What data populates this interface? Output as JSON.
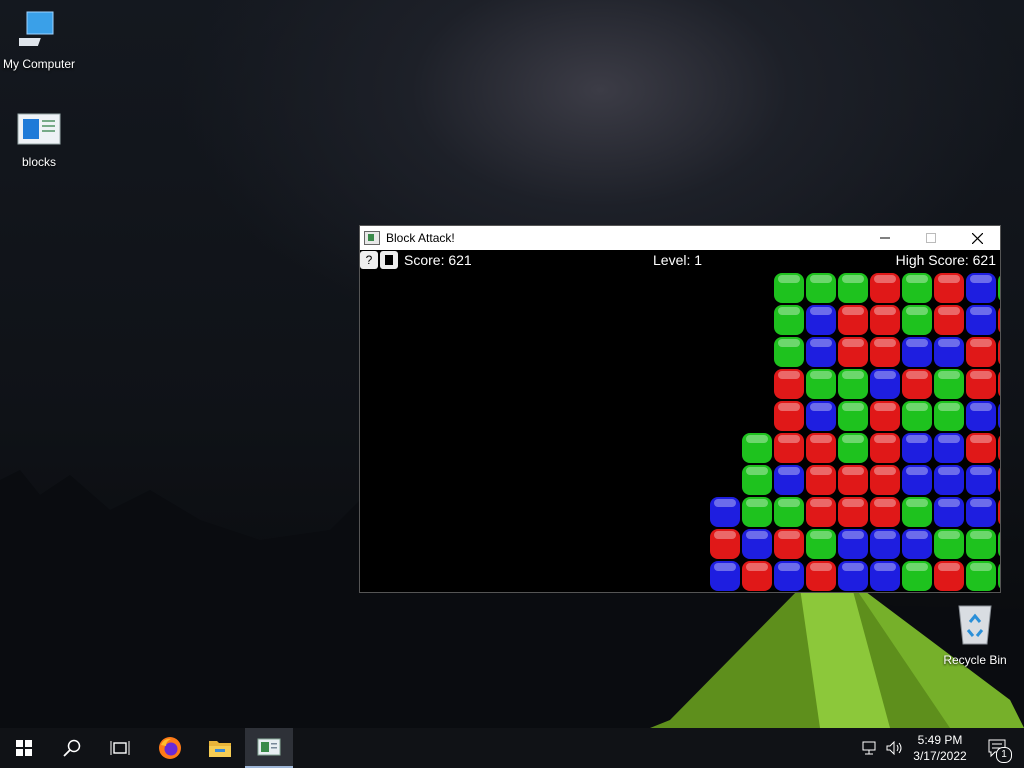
{
  "desktop": {
    "icons": [
      {
        "label": "My Computer",
        "icon": "computer-icon"
      },
      {
        "label": "blocks",
        "icon": "blocks-file-icon"
      },
      {
        "label": "Recycle Bin",
        "icon": "recycle-bin-icon"
      }
    ]
  },
  "window": {
    "title": "Block Attack!",
    "controls": [
      "minimize-icon",
      "maximize-icon",
      "close-icon"
    ]
  },
  "game": {
    "help_label": "?",
    "score_text": "Score: 621",
    "level_text": "Level: 1",
    "high_score_text": "High Score: 621",
    "colors": {
      "R": "#e01818",
      "G": "#1ec21e",
      "B": "#1e1ee0"
    },
    "board": [
      "...............GGGRGRBG",
      "...............GBRRGRBR",
      "...............GBRRBBRR",
      "...............RGGBRGRR",
      "...............RBGRGGBB",
      "..............GRRGRBBRR",
      "..............GBRRRBBBR",
      ".............BGGRRRGBBR",
      ".............RBRGBBBGGG",
      ".............BRBRBBGRGG"
    ]
  },
  "taskbar": {
    "items": [
      "start-icon",
      "search-icon",
      "task-view-icon",
      "firefox-icon",
      "file-explorer-icon",
      "block-attack-taskbar-icon"
    ],
    "time": "5:49 PM",
    "date": "3/17/2022",
    "notification_count": "1"
  }
}
